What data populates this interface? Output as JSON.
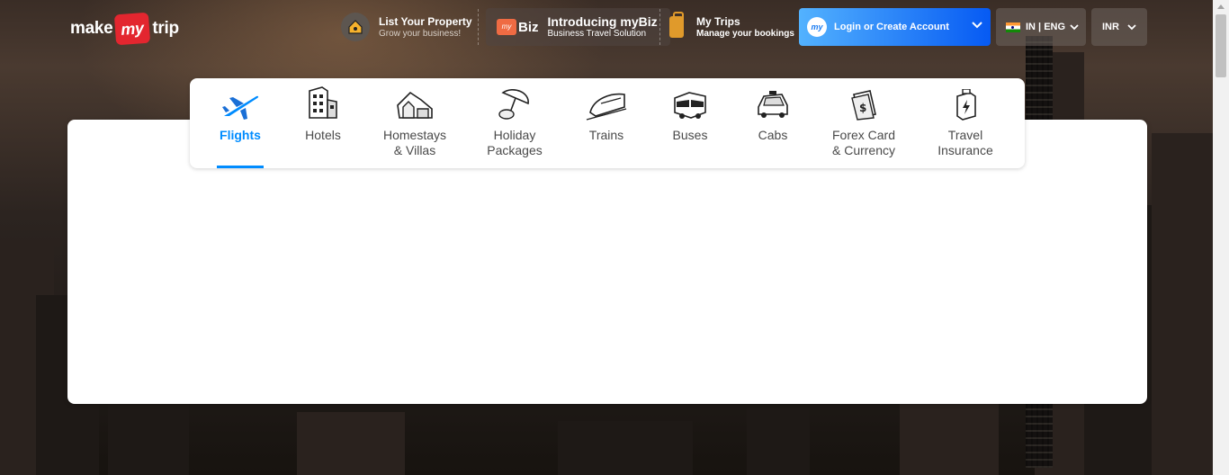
{
  "header": {
    "logo": {
      "part1": "make",
      "part2": "my",
      "part3": "trip"
    },
    "list_property": {
      "title": "List Your Property",
      "subtitle": "Grow your business!",
      "icon": "house-key-icon"
    },
    "mybiz": {
      "badge": "my",
      "brand": "Biz",
      "title": "Introducing myBiz",
      "subtitle": "Business Travel Solution",
      "icon": "briefcase-icon"
    },
    "my_trips": {
      "title": "My Trips",
      "subtitle": "Manage your bookings",
      "icon": "suitcase-icon"
    },
    "login": {
      "avatar": "my",
      "label": "Login or Create Account"
    },
    "language": {
      "label": "IN | ENG"
    },
    "currency": {
      "label": "INR"
    }
  },
  "nav": {
    "items": [
      {
        "label": "Flights",
        "icon": "flight-icon",
        "active": true
      },
      {
        "label": "Hotels",
        "icon": "hotel-icon"
      },
      {
        "label": "Homestays & Villas",
        "line1": "Homestays",
        "line2": "& Villas",
        "icon": "homestay-icon"
      },
      {
        "label": "Holiday Packages",
        "line1": "Holiday",
        "line2": "Packages",
        "icon": "beach-umbrella-icon"
      },
      {
        "label": "Trains",
        "icon": "train-icon"
      },
      {
        "label": "Buses",
        "icon": "bus-icon"
      },
      {
        "label": "Cabs",
        "icon": "cab-icon"
      },
      {
        "label": "Forex Card & Currency",
        "line1": "Forex Card",
        "line2": "& Currency",
        "icon": "forex-card-icon"
      },
      {
        "label": "Travel Insurance",
        "line1": "Travel",
        "line2": "Insurance",
        "icon": "insurance-icon"
      }
    ]
  },
  "colors": {
    "accent": "#008cff",
    "login_start": "#53b2fe",
    "login_end": "#065af3",
    "brand_red": "#e3262f"
  }
}
